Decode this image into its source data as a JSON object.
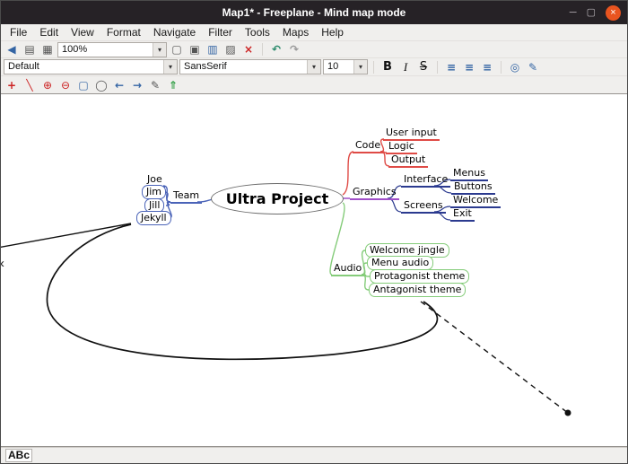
{
  "window": {
    "title": "Map1* - Freeplane - Mind map mode"
  },
  "window_controls": {
    "minimize": "─",
    "maximize": "▢",
    "close": "×"
  },
  "menu": {
    "items": [
      "File",
      "Edit",
      "View",
      "Format",
      "Navigate",
      "Filter",
      "Tools",
      "Maps",
      "Help"
    ]
  },
  "toolbar1": {
    "zoom_value": "100%"
  },
  "toolbar2": {
    "style_value": "Default",
    "font_value": "SansSerif",
    "size_value": "10",
    "bold_label": "B",
    "italic_label": "I",
    "strike_label": "S"
  },
  "icons": {
    "dropdown": "▾",
    "hide_toolbar": "◀",
    "note_panel": "▤",
    "attachments": "▦",
    "new_map": "▢",
    "open_map": "▣",
    "save_map": "▥",
    "print": "▨",
    "close_map": "×",
    "undo": "↶",
    "redo": "↷",
    "align_left": "≡",
    "align_center": "≡",
    "align_right": "≡",
    "view": "◎",
    "highlight": "✎",
    "add_node": "+",
    "connector": "╲",
    "zoom_in": "⊕",
    "zoom_out": "⊖",
    "select": "▢",
    "magnifier": "◯",
    "back": "←",
    "forward": "→",
    "pencil": "✎",
    "paste": "⇑",
    "fold": "‹"
  },
  "map": {
    "root": "Ultra Project",
    "nodes": [
      "Team",
      "Joe",
      "Jim",
      "Jill",
      "Jekyll",
      "Code",
      "User input",
      "Logic",
      "Output",
      "Graphics",
      "Interface",
      "Menus",
      "Buttons",
      "Screens",
      "Welcome",
      "Exit",
      "Audio",
      "Welcome jingle",
      "Menu audio",
      "Protagonist theme",
      "Antagonist theme"
    ]
  },
  "colors": {
    "team_branch": "#4a63b8",
    "code_branch": "#df4b46",
    "graphics_branch": "#a04fc8",
    "sub_branch": "#2b3a8f",
    "audio_branch": "#85cc7a",
    "connector": "#111111",
    "titlebar_bg": "#262226",
    "close_button": "#e9541f",
    "toolbar_bg": "#f0efed"
  },
  "statusbar": {
    "spell_label": "ABc"
  }
}
